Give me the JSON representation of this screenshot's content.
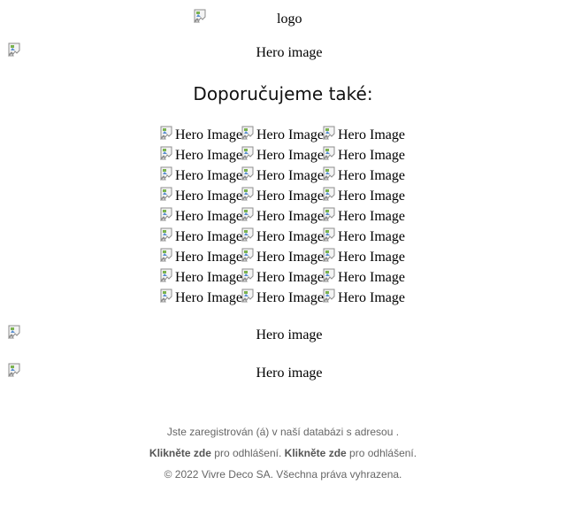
{
  "logo": {
    "alt": "logo"
  },
  "hero_top": {
    "alt": "Hero image"
  },
  "recommend": {
    "heading": "Doporučujeme také:",
    "rows": [
      [
        "Hero Image",
        "Hero Image",
        "Hero Image"
      ],
      [
        "Hero Image",
        "Hero Image",
        "Hero Image"
      ],
      [
        "Hero Image",
        "Hero Image",
        "Hero Image"
      ],
      [
        "Hero Image",
        "Hero Image",
        "Hero Image"
      ],
      [
        "Hero Image",
        "Hero Image",
        "Hero Image"
      ],
      [
        "Hero Image",
        "Hero Image",
        "Hero Image"
      ],
      [
        "Hero Image",
        "Hero Image",
        "Hero Image"
      ],
      [
        "Hero Image",
        "Hero Image",
        "Hero Image"
      ],
      [
        "Hero Image",
        "Hero Image",
        "Hero Image"
      ]
    ]
  },
  "hero_mid": {
    "alt": "Hero image"
  },
  "hero_bottom": {
    "alt": "Hero image"
  },
  "footer": {
    "registered_text": "Jste zaregistrován (á) v naší databázi s adresou .",
    "unsubscribe_link_1": "Klikněte zde",
    "unsubscribe_text_1": " pro odhlášení. ",
    "unsubscribe_link_2": "Klikněte zde",
    "unsubscribe_text_2": " pro odhlášení.",
    "copyright": "© 2022 Vivre Deco SA. Všechna práva vyhrazena."
  },
  "icons": {
    "broken_image": "broken-image-icon"
  }
}
